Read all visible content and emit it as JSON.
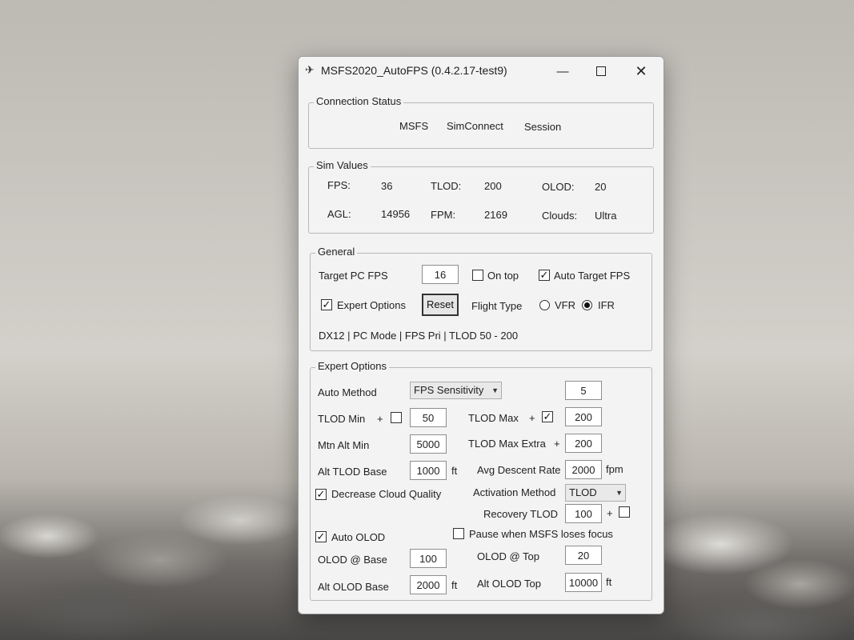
{
  "window": {
    "title": "MSFS2020_AutoFPS (0.4.2.17-test9)",
    "min_glyph": "—",
    "close_glyph": "✕"
  },
  "connection": {
    "label": "Connection Status",
    "items": [
      "MSFS",
      "SimConnect",
      "Session"
    ]
  },
  "sim_values": {
    "label": "Sim Values",
    "fps_label": "FPS:",
    "fps": "36",
    "tlod_label": "TLOD:",
    "tlod": "200",
    "olod_label": "OLOD:",
    "olod": "20",
    "agl_label": "AGL:",
    "agl": "14956",
    "fpm_label": "FPM:",
    "fpm": "2169",
    "clouds_label": "Clouds:",
    "clouds": "Ultra"
  },
  "general": {
    "label": "General",
    "target_fps_label": "Target PC FPS",
    "target_fps": "16",
    "on_top_label": "On top",
    "on_top_checked": false,
    "auto_target_label": "Auto Target FPS",
    "auto_target_checked": true,
    "expert_label": "Expert Options",
    "expert_checked": true,
    "reset_label": "Reset",
    "flight_type_label": "Flight Type",
    "vfr_label": "VFR",
    "ifr_label": "IFR",
    "flight_type_selected": "IFR",
    "status_line": "DX12 | PC Mode | FPS Pri | TLOD 50 - 200"
  },
  "expert": {
    "label": "Expert Options",
    "auto_method_label": "Auto Method",
    "auto_method_value": "FPS Sensitivity",
    "sensitivity": "5",
    "tlod_min_label": "TLOD Min",
    "tlod_min_plus": "+",
    "tlod_min_checked": false,
    "tlod_min": "50",
    "tlod_max_label": "TLOD Max",
    "tlod_max_plus": "+",
    "tlod_max_checked": true,
    "tlod_max": "200",
    "mtn_alt_min_label": "Mtn Alt Min",
    "mtn_alt_min": "5000",
    "tlod_max_extra_label": "TLOD Max Extra",
    "tlod_max_extra_plus": "+",
    "tlod_max_extra": "200",
    "alt_tlod_base_label": "Alt TLOD Base",
    "alt_tlod_base": "1000",
    "ft_unit": "ft",
    "avg_descent_label": "Avg Descent Rate",
    "avg_descent": "2000",
    "fpm_unit": "fpm",
    "decrease_cloud_label": "Decrease Cloud Quality",
    "decrease_cloud_checked": true,
    "activation_label": "Activation Method",
    "activation_value": "TLOD",
    "recovery_tlod_label": "Recovery TLOD",
    "recovery_tlod": "100",
    "recovery_plus": "+",
    "recovery_checked": false,
    "auto_olod_label": "Auto OLOD",
    "auto_olod_checked": true,
    "pause_label": "Pause when MSFS loses focus",
    "pause_checked": false,
    "olod_base_label": "OLOD @ Base",
    "olod_base": "100",
    "olod_top_label": "OLOD @ Top",
    "olod_top": "20",
    "alt_olod_base_label": "Alt OLOD Base",
    "alt_olod_base": "2000",
    "alt_olod_top_label": "Alt OLOD Top",
    "alt_olod_top": "10000"
  },
  "icons": {
    "check": "✓",
    "dropdown": "▼"
  }
}
